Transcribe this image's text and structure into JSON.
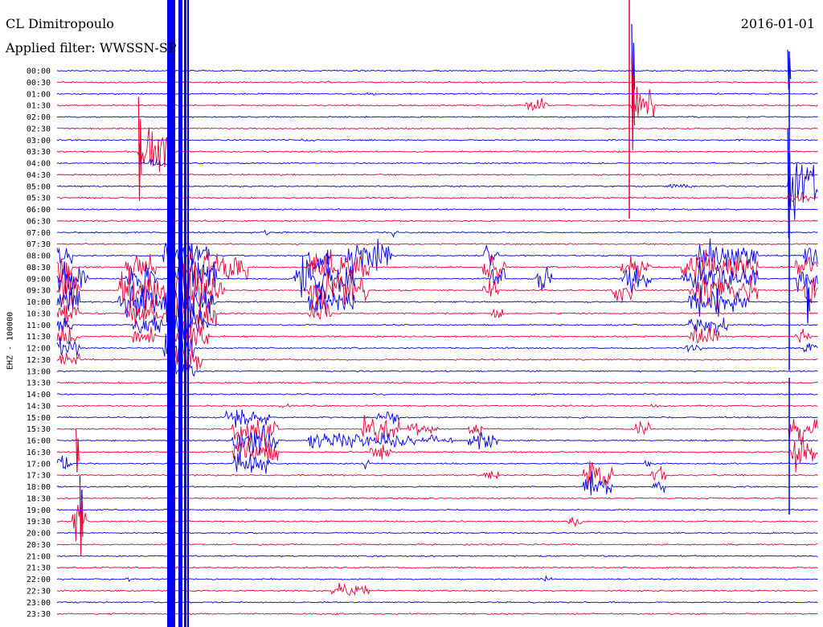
{
  "header": {
    "station": "CL Dimitropoulo",
    "filter": "Applied filter: WWSSN-SP",
    "date": "2016-01-01"
  },
  "colors": {
    "trace_a": "#0000ee",
    "trace_b": "#ee0033",
    "background": "#ffffff"
  },
  "chart_data": {
    "type": "line",
    "title": "CL Dimitropoulo",
    "ylabel": "EHZ - 100000",
    "row_labels": [
      "00:00",
      "00:30",
      "01:00",
      "01:30",
      "02:00",
      "02:30",
      "03:00",
      "03:30",
      "04:00",
      "04:30",
      "05:00",
      "05:30",
      "06:00",
      "06:30",
      "07:00",
      "07:30",
      "08:00",
      "08:30",
      "09:00",
      "09:30",
      "10:00",
      "10:30",
      "11:00",
      "11:30",
      "12:00",
      "12:30",
      "13:00",
      "13:30",
      "14:00",
      "14:30",
      "15:00",
      "15:30",
      "16:00",
      "16:30",
      "17:00",
      "17:30",
      "18:00",
      "18:30",
      "19:00",
      "19:30",
      "20:00",
      "20:30",
      "21:00",
      "21:30",
      "22:00",
      "22:30",
      "23:00",
      "23:30"
    ],
    "x_minutes_per_row": 30,
    "grid": false,
    "series": [
      {
        "color": "trace_a"
      },
      {
        "color": "trace_b"
      }
    ]
  }
}
